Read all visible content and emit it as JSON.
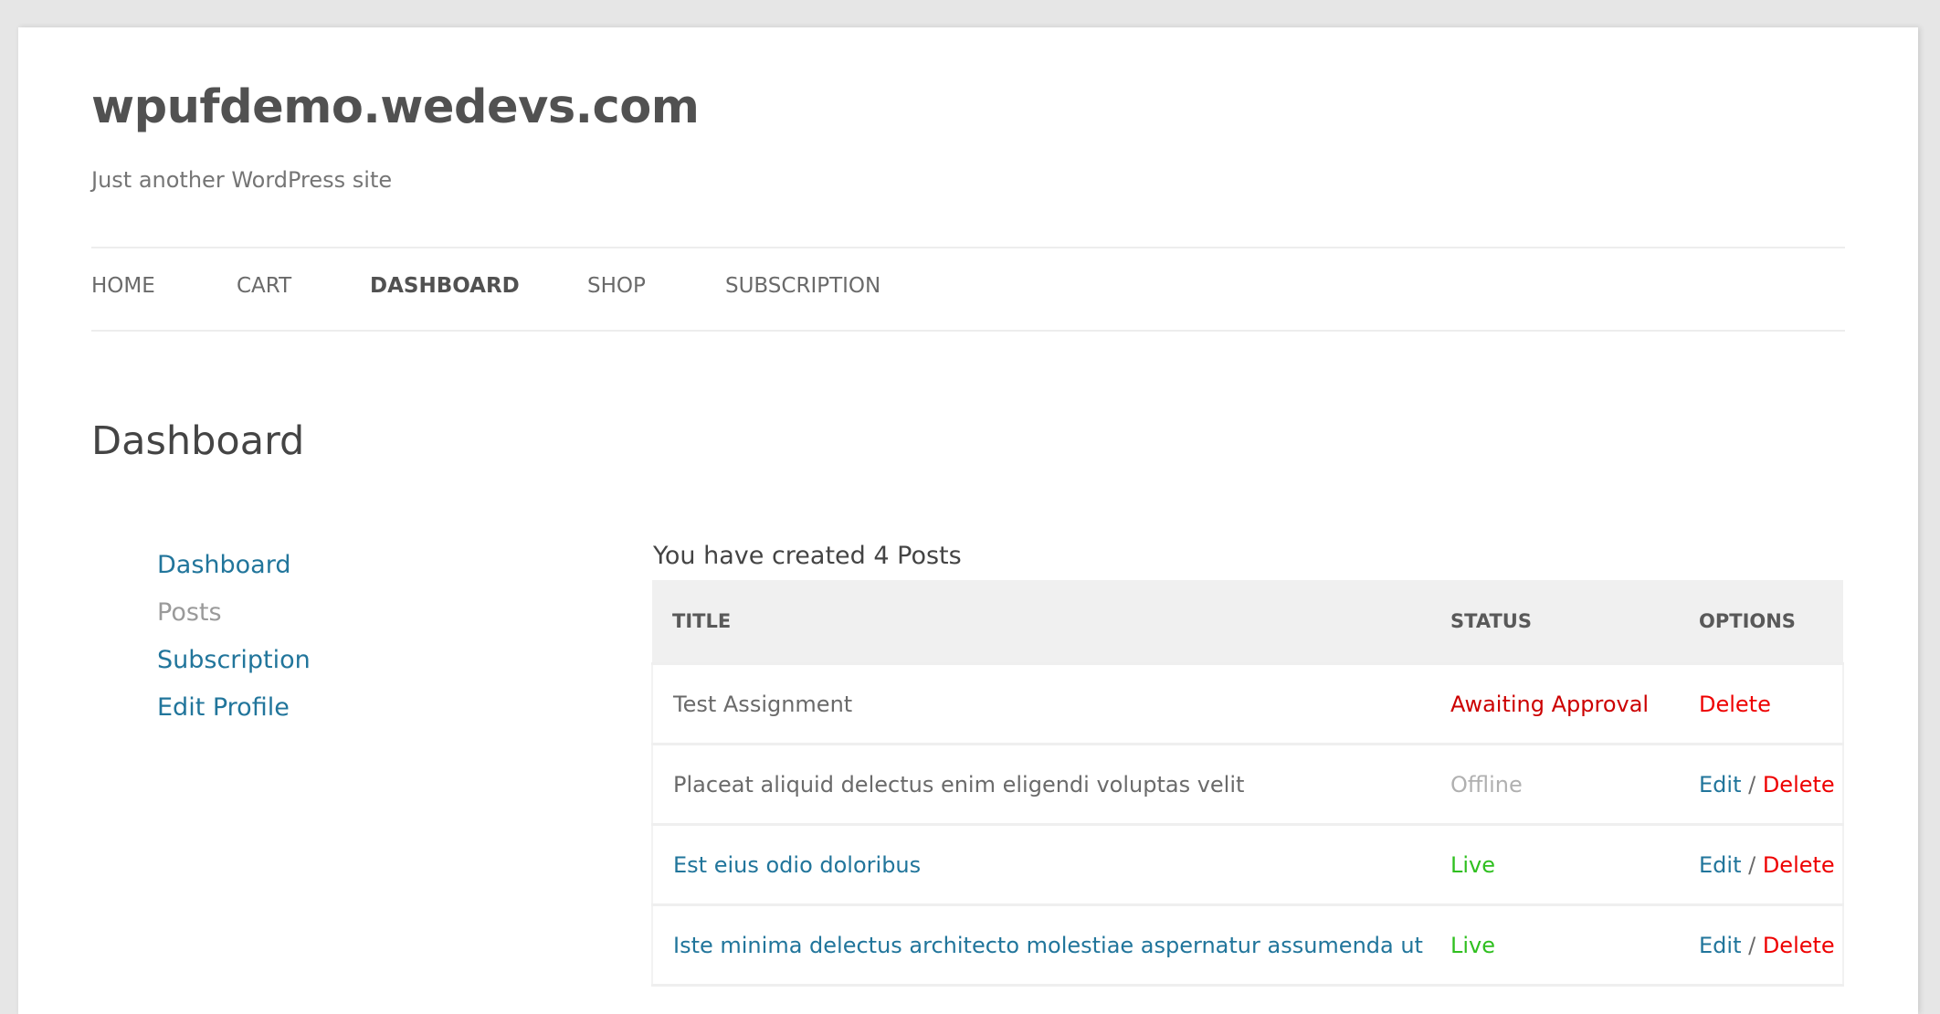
{
  "site": {
    "title": "wpufdemo.wedevs.com",
    "tagline": "Just another WordPress site"
  },
  "nav": {
    "items": [
      {
        "label": "HOME",
        "active": false
      },
      {
        "label": "CART",
        "active": false
      },
      {
        "label": "DASHBOARD",
        "active": true
      },
      {
        "label": "SHOP",
        "active": false
      },
      {
        "label": "SUBSCRIPTION",
        "active": false
      }
    ]
  },
  "page": {
    "heading": "Dashboard"
  },
  "sidebar": {
    "items": [
      {
        "label": "Dashboard",
        "current": false
      },
      {
        "label": "Posts",
        "current": true
      },
      {
        "label": "Subscription",
        "current": false
      },
      {
        "label": "Edit Profile",
        "current": false
      }
    ]
  },
  "posts": {
    "summary": "You have created 4 Posts",
    "columns": [
      "TITLE",
      "STATUS",
      "OPTIONS"
    ],
    "edit_label": "Edit",
    "delete_label": "Delete",
    "separator": "/",
    "rows": [
      {
        "title": "Test Assignment",
        "title_is_link": false,
        "status": "Awaiting Approval",
        "status_color": "#cc0000",
        "can_edit": false
      },
      {
        "title": "Placeat aliquid delectus enim eligendi voluptas velit",
        "title_is_link": false,
        "status": "Offline",
        "status_color": "#b0b0b0",
        "can_edit": true
      },
      {
        "title": "Est eius odio doloribus",
        "title_is_link": true,
        "status": "Live",
        "status_color": "#2fbf1f",
        "can_edit": true
      },
      {
        "title": "Iste minima delectus architecto molestiae aspernatur assumenda ut",
        "title_is_link": true,
        "status": "Live",
        "status_color": "#2fbf1f",
        "can_edit": true
      }
    ]
  },
  "colors": {
    "link": "#21759b",
    "delete": "#ee0000",
    "background": "#e6e6e6"
  }
}
